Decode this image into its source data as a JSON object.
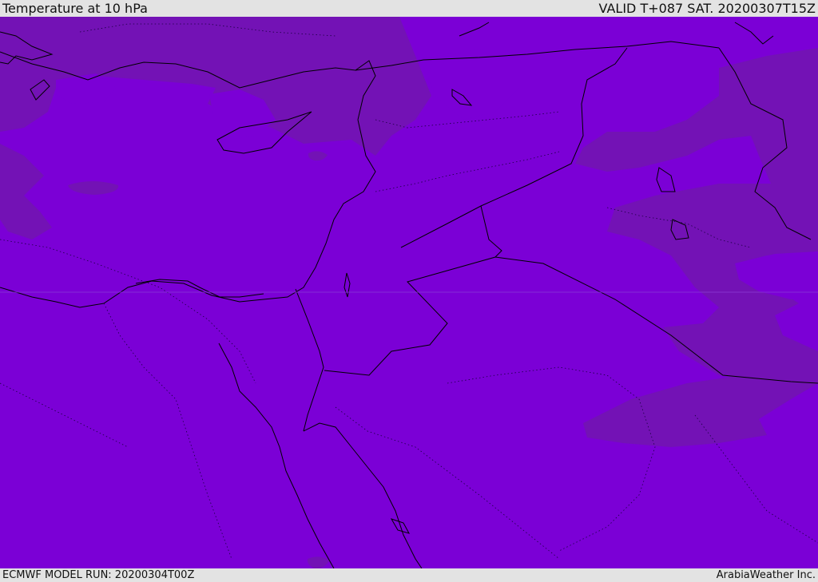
{
  "header": {
    "title": "Temperature at 10 hPa",
    "valid": "VALID T+087 SAT. 20200307T15Z"
  },
  "footer": {
    "model_run": "ECMWF MODEL RUN: 20200304T00Z",
    "credit": "ArabiaWeather Inc."
  },
  "colors": {
    "field_main": "#7b00d6",
    "field_dark": "#7312b5",
    "boundary": "#000000",
    "bar_bg": "#e3e3e3"
  }
}
